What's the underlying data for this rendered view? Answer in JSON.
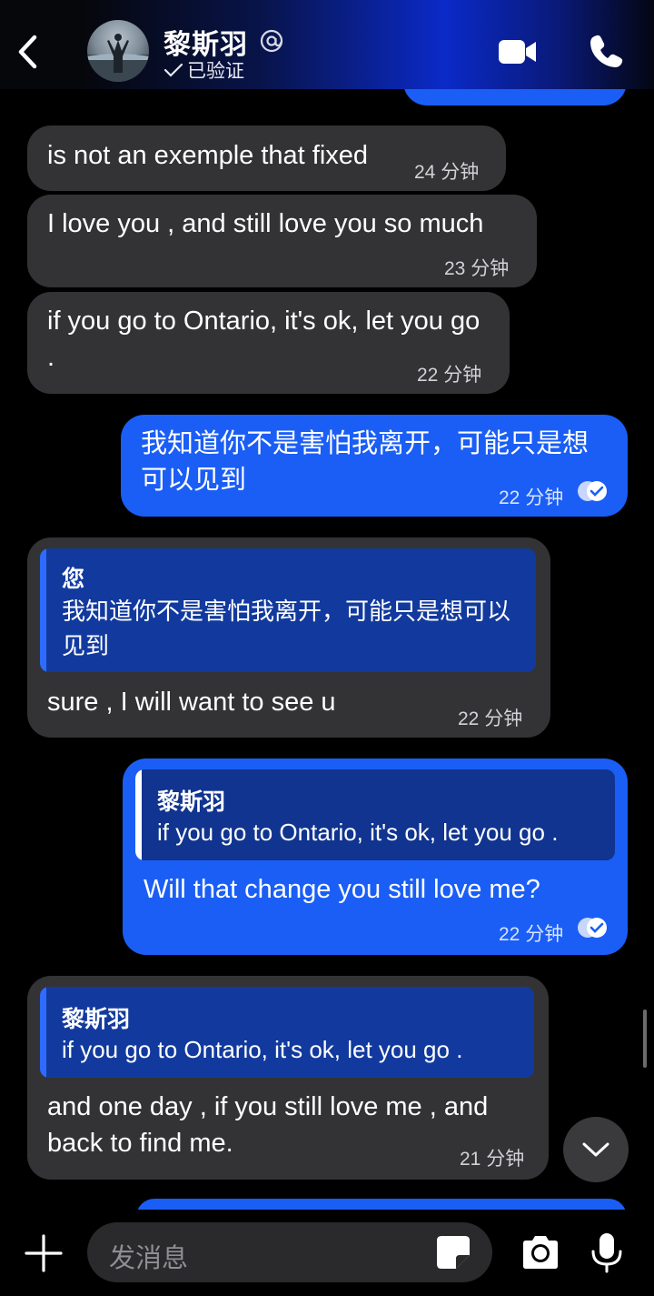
{
  "header": {
    "contact_name": "黎斯羽",
    "verified_label": "已验证"
  },
  "messages": [
    {
      "direction": "in",
      "text": "is not an exemple that fixed",
      "time": "24 分钟"
    },
    {
      "direction": "in",
      "text": "I love you , and still love you so much",
      "time": "23 分钟"
    },
    {
      "direction": "in",
      "text": "if you go to Ontario, it's ok, let you go .",
      "time": "22 分钟"
    },
    {
      "direction": "out",
      "text": "我知道你不是害怕我离开，可能只是想可以见到",
      "time": "22 分钟",
      "status": "read"
    },
    {
      "direction": "in",
      "quote": {
        "name": "您",
        "text": "我知道你不是害怕我离开，可能只是想可以见到"
      },
      "text": "sure , I will want to see u",
      "time": "22 分钟"
    },
    {
      "direction": "out",
      "quote": {
        "name": "黎斯羽",
        "text": "if you go to Ontario, it's ok, let you go ."
      },
      "text": "Will that change you still love me?",
      "time": "22 分钟",
      "status": "read"
    },
    {
      "direction": "in",
      "quote": {
        "name": "黎斯羽",
        "text": "if you go to Ontario, it's ok, let you go ."
      },
      "text": "and one day , if you still love me , and back to find me.",
      "time": "21 分钟"
    }
  ],
  "composer": {
    "placeholder": "发消息"
  },
  "colors": {
    "incoming_bubble": "#333335",
    "outgoing_bubble": "#1a5ef5",
    "quote_in": "#123a9e",
    "quote_out": "#10348f"
  },
  "icons": [
    "back-chevron-icon",
    "at-icon",
    "check-icon",
    "video-call-icon",
    "phone-call-icon",
    "read-receipt-icon",
    "chevron-down-icon",
    "plus-icon",
    "sticker-icon",
    "camera-icon",
    "microphone-icon"
  ]
}
